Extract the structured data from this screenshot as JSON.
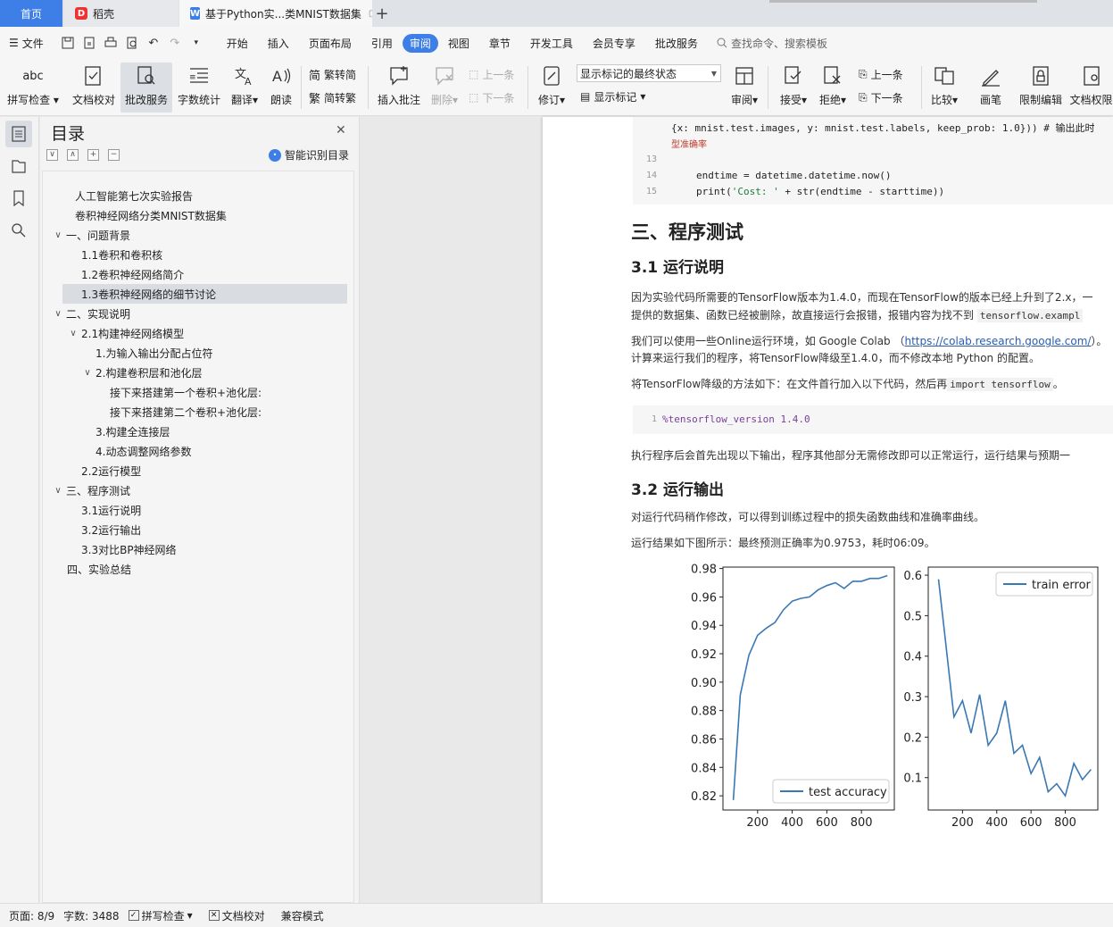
{
  "tabs": {
    "home": "首页",
    "daoke": "稻壳",
    "doc": "基于Python实...类MNIST数据集",
    "plus": "+"
  },
  "menu": {
    "file": "文件",
    "items": [
      "开始",
      "插入",
      "页面布局",
      "引用",
      "审阅",
      "视图",
      "章节",
      "开发工具",
      "会员专享",
      "批改服务"
    ],
    "active": "审阅",
    "search": "查找命令、搜索模板"
  },
  "ribbon": {
    "spell": "拼写检查",
    "proof": "文档校对",
    "correct": "批改服务",
    "wordcount": "字数统计",
    "translate": "翻译",
    "read": "朗读",
    "to_simplified": "繁转简",
    "to_traditional": "简转繁",
    "insert_comment": "插入批注",
    "delete": "删除",
    "prev": "上一条",
    "next": "下一条",
    "track": "修订",
    "markup_select": "显示标记的最终状态",
    "show_markup": "显示标记",
    "review": "审阅",
    "accept": "接受",
    "reject": "拒绝",
    "prev2": "上一条",
    "next2": "下一条",
    "compare": "比较",
    "pen": "画笔",
    "restrict": "限制编辑",
    "permission": "文档权限"
  },
  "toc": {
    "title": "目录",
    "smart": "智能识别目录",
    "items": [
      {
        "label": "人工智能第七次实验报告"
      },
      {
        "label": "卷积神经网络分类MNIST数据集"
      },
      {
        "label": "一、问题背景",
        "chev": "∨"
      },
      {
        "label": "1.1卷积和卷积核"
      },
      {
        "label": "1.2卷积神经网络简介"
      },
      {
        "label": "1.3卷积神经网络的细节讨论"
      },
      {
        "label": "二、实现说明",
        "chev": "∨"
      },
      {
        "label": "2.1构建神经网络模型",
        "chev": "∨"
      },
      {
        "label": "1.为输入输出分配占位符"
      },
      {
        "label": "2.构建卷积层和池化层",
        "chev": "∨"
      },
      {
        "label": "接下来搭建第一个卷积+池化层:"
      },
      {
        "label": "接下来搭建第二个卷积+池化层:"
      },
      {
        "label": "3.构建全连接层"
      },
      {
        "label": "4.动态调整网络参数"
      },
      {
        "label": "2.2运行模型"
      },
      {
        "label": "三、程序测试",
        "chev": "∨"
      },
      {
        "label": "3.1运行说明"
      },
      {
        "label": "3.2运行输出"
      },
      {
        "label": "3.3对比BP神经网络"
      },
      {
        "label": "四、实验总结"
      }
    ]
  },
  "doc": {
    "code_line0": "{x: mnist.test.images, y: mnist.test.labels, keep_prob: 1.0})) # 输出此时",
    "code_line0b": "型准确率",
    "ln13": "13",
    "ln14": "14",
    "ln15": "15",
    "code14": "endtime = datetime.datetime.now()",
    "code15_a": "print(",
    "code15_str": "'Cost: '",
    "code15_b": " + str(endtime - starttime))",
    "h_test": "三、程序测试",
    "h_31": "3.1 运行说明",
    "p1a": "因为实验代码所需要的TensorFlow版本为1.4.0，而现在TensorFlow的版本已经上升到了2.x，一",
    "p1b_pre": "提供的数据集、函数已经被删除，故直接运行会报错，报错内容为找不到",
    "p1b_code": "tensorflow.exampl",
    "p2a_pre": "我们可以使用一些Online运行环境，如 Google Colab （",
    "p2a_link": "https://colab.research.google.com/",
    "p2a_post": "）。",
    "p2b": "计算来运行我们的程序，将TensorFlow降级至1.4.0，而不修改本地 Python 的配置。",
    "p3_pre": "将TensorFlow降级的方法如下：在文件首行加入以下代码，然后再",
    "p3_code": "import tensorflow",
    "p3_post": "。",
    "ln1": "1",
    "code_magic": "%tensorflow_version 1.4.0",
    "p4": "执行程序后会首先出现以下输出，程序其他部分无需修改即可以正常运行，运行结果与预期一",
    "h_32": "3.2 运行输出",
    "p5": "对运行代码稍作修改，可以得到训练过程中的损失函数曲线和准确率曲线。",
    "p6": "运行结果如下图所示：最终预测正确率为0.9753，耗时06:09。"
  },
  "chart_data": [
    {
      "type": "line",
      "series": [
        {
          "name": "test accuracy",
          "color": "#3a78b5",
          "x": [
            60,
            100,
            150,
            200,
            250,
            300,
            350,
            400,
            450,
            500,
            550,
            600,
            650,
            700,
            750,
            800,
            850,
            900,
            950
          ],
          "values": [
            0.817,
            0.891,
            0.919,
            0.933,
            0.938,
            0.942,
            0.951,
            0.957,
            0.959,
            0.96,
            0.965,
            0.968,
            0.97,
            0.966,
            0.971,
            0.971,
            0.973,
            0.973,
            0.975
          ]
        }
      ],
      "xticks": [
        "200",
        "400",
        "600",
        "800"
      ],
      "yticks": [
        "0.98",
        "0.96",
        "0.94",
        "0.92",
        "0.90",
        "0.88",
        "0.86",
        "0.84",
        "0.82"
      ],
      "xlim": [
        0,
        990
      ],
      "ylim": [
        0.81,
        0.981
      ],
      "legend": "lower-right"
    },
    {
      "type": "line",
      "series": [
        {
          "name": "train error",
          "color": "#3a78b5",
          "x": [
            60,
            100,
            150,
            200,
            250,
            300,
            350,
            400,
            450,
            500,
            550,
            600,
            650,
            700,
            750,
            800,
            850,
            900,
            950
          ],
          "values": [
            0.59,
            0.44,
            0.25,
            0.29,
            0.21,
            0.305,
            0.18,
            0.21,
            0.29,
            0.16,
            0.18,
            0.11,
            0.15,
            0.065,
            0.085,
            0.055,
            0.135,
            0.095,
            0.12
          ]
        }
      ],
      "xticks": [
        "200",
        "400",
        "600",
        "800"
      ],
      "yticks": [
        "0.6",
        "0.5",
        "0.4",
        "0.3",
        "0.2",
        "0.1"
      ],
      "xlim": [
        0,
        990
      ],
      "ylim": [
        0.02,
        0.62
      ],
      "legend": "upper-right"
    }
  ],
  "status": {
    "page": "页面: 8/9",
    "words": "字数: 3488",
    "spell": "拼写检查",
    "proof": "文档校对",
    "compat": "兼容模式"
  }
}
